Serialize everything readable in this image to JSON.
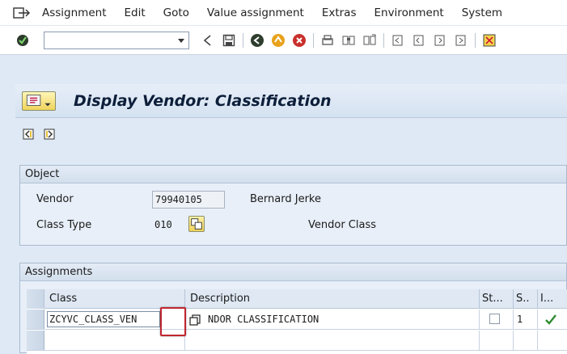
{
  "menubar": {
    "items": [
      {
        "label": "Assignment"
      },
      {
        "label": "Edit"
      },
      {
        "label": "Goto"
      },
      {
        "label": "Value assignment"
      },
      {
        "label": "Extras"
      },
      {
        "label": "Environment"
      },
      {
        "label": "System"
      }
    ]
  },
  "toolbar": {
    "command_value": "",
    "icons": [
      "enter-icon",
      "back-icon",
      "save-icon",
      "back-green-icon",
      "exit-icon",
      "cancel-icon",
      "print-icon",
      "find-icon",
      "find-next-icon",
      "first-page-icon",
      "prev-page-icon",
      "next-page-icon",
      "last-page-icon",
      "layout-icon"
    ]
  },
  "title": {
    "text": "Display Vendor: Classification"
  },
  "object": {
    "header": "Object",
    "vendor_label": "Vendor",
    "vendor_value": "79940105",
    "vendor_name": "Bernard Jerke",
    "class_type_label": "Class Type",
    "class_type_value": "010",
    "class_type_desc": "Vendor Class"
  },
  "assignments": {
    "header": "Assignments",
    "columns": [
      "Class",
      "Description",
      "St...",
      "S..",
      "I..."
    ],
    "rows": [
      {
        "class": "ZCYVC_CLASS_VEN",
        "description": "NDOR CLASSIFICATION",
        "status_checked": false,
        "s": "1",
        "i": "check"
      },
      {
        "class": "",
        "description": "",
        "status_checked": null,
        "s": "",
        "i": ""
      }
    ]
  },
  "colors": {
    "accent": "#dfe9f5",
    "highlight": "#c0262f",
    "check": "#2e8b2e"
  }
}
